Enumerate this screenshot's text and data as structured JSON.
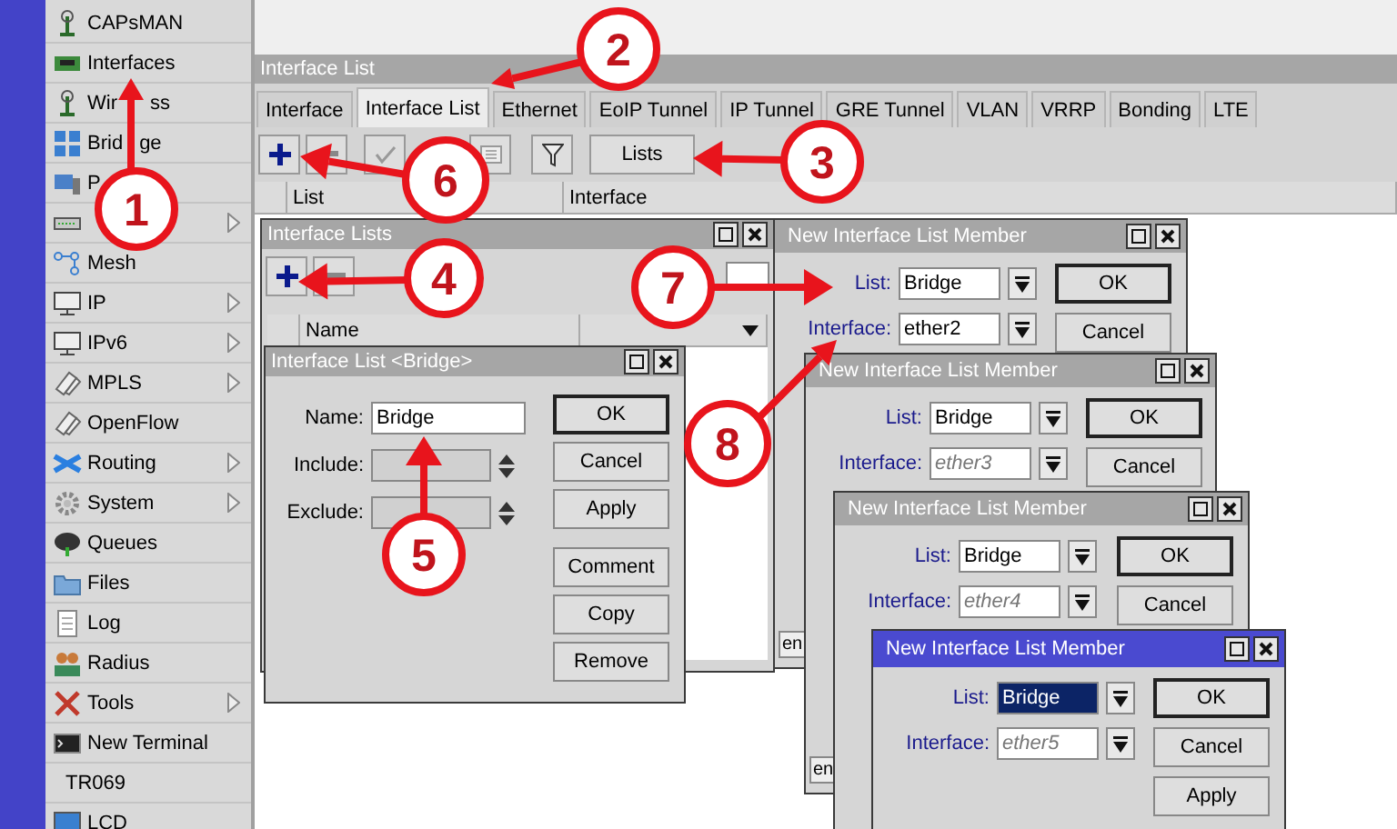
{
  "sidebar": {
    "items": [
      {
        "label": "CAPsMAN",
        "has_submenu": false
      },
      {
        "label": "Interfaces",
        "has_submenu": false
      },
      {
        "label": "Wir",
        "label_tail": "ss",
        "has_submenu": false
      },
      {
        "label": "Brid",
        "label_tail": "ge",
        "has_submenu": false
      },
      {
        "label": "P",
        "has_submenu": false
      },
      {
        "has_submenu": true
      },
      {
        "label": "Mesh",
        "has_submenu": false
      },
      {
        "label": "IP",
        "has_submenu": true
      },
      {
        "label": "IPv6",
        "has_submenu": true
      },
      {
        "label": "MPLS",
        "has_submenu": true
      },
      {
        "label": "OpenFlow",
        "has_submenu": false
      },
      {
        "label": "Routing",
        "has_submenu": true
      },
      {
        "label": "System",
        "has_submenu": true
      },
      {
        "label": "Queues",
        "has_submenu": false
      },
      {
        "label": "Files",
        "has_submenu": false
      },
      {
        "label": "Log",
        "has_submenu": false
      },
      {
        "label": "Radius",
        "has_submenu": false
      },
      {
        "label": "Tools",
        "has_submenu": true
      },
      {
        "label": "New Terminal",
        "has_submenu": false
      },
      {
        "label": "TR069",
        "has_submenu": false
      },
      {
        "label": "LCD",
        "has_submenu": false
      }
    ]
  },
  "main_window": {
    "title": "Interface List",
    "tabs": [
      {
        "label": "Interface",
        "selected": false
      },
      {
        "label": "Interface List",
        "selected": true
      },
      {
        "label": "Ethernet",
        "selected": false
      },
      {
        "label": "EoIP Tunnel",
        "selected": false
      },
      {
        "label": "IP Tunnel",
        "selected": false
      },
      {
        "label": "GRE Tunnel",
        "selected": false
      },
      {
        "label": "VLAN",
        "selected": false
      },
      {
        "label": "VRRP",
        "selected": false
      },
      {
        "label": "Bonding",
        "selected": false
      },
      {
        "label": "LTE",
        "selected": false
      }
    ],
    "lists_button": "Lists",
    "columns": [
      "List",
      "Interface"
    ]
  },
  "interface_lists_window": {
    "title": "Interface Lists",
    "columns": [
      "Name"
    ]
  },
  "list_dialog": {
    "title": "Interface List <Bridge>",
    "fields": [
      {
        "kind": "text",
        "label": "Name:",
        "value": "Bridge"
      },
      {
        "kind": "spinner",
        "label": "Include:"
      },
      {
        "kind": "spinner",
        "label": "Exclude:"
      }
    ],
    "button_groups": [
      [
        "OK",
        "Cancel",
        "Apply"
      ],
      [
        "Comment",
        "Copy",
        "Remove"
      ]
    ]
  },
  "member_windows": [
    {
      "title": "New Interface List Member",
      "active": false,
      "list": {
        "label": "List:",
        "value": "Bridge",
        "selected": false
      },
      "interface": {
        "label": "Interface:",
        "value": "ether2"
      },
      "buttons": [
        "OK",
        "Cancel"
      ],
      "status": "en"
    },
    {
      "title": "New Interface List Member",
      "active": false,
      "list": {
        "label": "List:",
        "value": "Bridge",
        "selected": false
      },
      "interface": {
        "label": "Interface:",
        "placeholder": "ether3"
      },
      "buttons": [
        "OK",
        "Cancel"
      ],
      "status": "en"
    },
    {
      "title": "New Interface List Member",
      "active": false,
      "list": {
        "label": "List:",
        "value": "Bridge",
        "selected": false
      },
      "interface": {
        "label": "Interface:",
        "placeholder": "ether4"
      },
      "buttons": [
        "OK",
        "Cancel"
      ]
    },
    {
      "title": "New Interface List Member",
      "active": true,
      "list": {
        "label": "List:",
        "value": "Bridge",
        "selected": true
      },
      "interface": {
        "label": "Interface:",
        "placeholder": "ether5"
      },
      "buttons": [
        "OK",
        "Cancel",
        "Apply"
      ]
    }
  ],
  "annotations": [
    {
      "number": "1"
    },
    {
      "number": "2"
    },
    {
      "number": "3"
    },
    {
      "number": "4"
    },
    {
      "number": "5"
    },
    {
      "number": "6"
    },
    {
      "number": "7"
    },
    {
      "number": "8"
    }
  ]
}
